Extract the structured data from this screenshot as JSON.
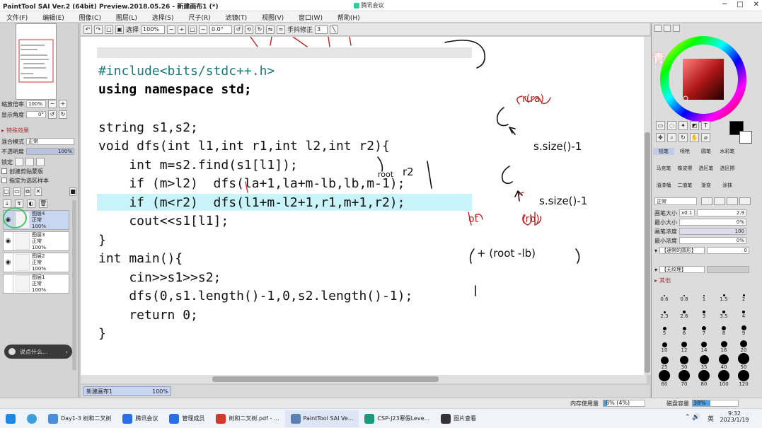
{
  "window": {
    "title": "PaintTool SAI Ver.2 (64bit) Preview.2018.05.26 - 新建画布1 (*)",
    "meeting_label": "腾讯会议",
    "controls": [
      "─",
      "□",
      "✕"
    ]
  },
  "menu": [
    "文件(F)",
    "编辑(E)",
    "图像(C)",
    "图层(L)",
    "选择(S)",
    "尺子(R)",
    "滤镜(T)",
    "视图(V)",
    "窗口(W)",
    "帮助(H)"
  ],
  "toolbar": {
    "select_label": "选择",
    "zoom": "100%",
    "rotation": "0.0°",
    "stabilizer_label": "手抖修正",
    "stabilizer_value": "3"
  },
  "left_panel": {
    "zoom_label": "缩放倍率",
    "zoom_value": "100%",
    "angle_label": "显示角度",
    "angle_value": "0°",
    "effects_label": "特殊效果",
    "blend_label": "混合模式",
    "blend_value": "正常",
    "opacity_label": "不透明度",
    "opacity_value": "100%",
    "lock_label": "锁定",
    "clip_label": "创建剪贴蒙版",
    "ref_label": "指定为选区样本",
    "layers": [
      {
        "name": "图层4",
        "mode": "正常",
        "opacity": "100%",
        "visible": true,
        "selected": true
      },
      {
        "name": "图层3",
        "mode": "正常",
        "opacity": "100%",
        "visible": true,
        "selected": false
      },
      {
        "name": "图层2",
        "mode": "正常",
        "opacity": "100%",
        "visible": true,
        "selected": false
      },
      {
        "name": "图层1",
        "mode": "正常",
        "opacity": "100%",
        "visible": false,
        "selected": false
      }
    ],
    "chat_placeholder": "说点什么..."
  },
  "code_lines": [
    {
      "text": "#include<bits/stdc++.h>",
      "kind": "pp"
    },
    {
      "text": "using namespace std;",
      "kind": "kwline"
    },
    {
      "text": "",
      "kind": "blank"
    },
    {
      "text": "string s1,s2;",
      "kind": "decl"
    },
    {
      "text": "void dfs(int l1,int r1,int l2,int r2){",
      "kind": "sig"
    },
    {
      "text": "    int m=s2.find(s1[l1]);",
      "kind": "body"
    },
    {
      "text": "    if (m>l2)  dfs(la+1,la+m-lb,lb,m-1);",
      "kind": "body"
    },
    {
      "text": "    if (m<r2)  dfs(l1+m-l2+1,r1,m+1,r2);",
      "kind": "body"
    },
    {
      "text": "    cout<<s1[l1];",
      "kind": "body"
    },
    {
      "text": "}",
      "kind": "brace"
    },
    {
      "text": "int main(){",
      "kind": "sig"
    },
    {
      "text": "    cin>>s1>>s2;",
      "kind": "body"
    },
    {
      "text": "    dfs(0,s1.length()-1,0,s2.length()-1);",
      "kind": "body"
    },
    {
      "text": "    return 0;",
      "kind": "body"
    },
    {
      "text": "}",
      "kind": "brace"
    }
  ],
  "canvas_tab": {
    "name": "新建画布1",
    "zoom": "100%"
  },
  "right_panel": {
    "watermark": "青",
    "brushes": [
      "铅笔",
      "喷枪",
      "圆笔",
      "水彩笔",
      "马克笔",
      "橡皮擦",
      "选区笔",
      "选区擦",
      "油漆桶",
      "二值笔",
      "渐变",
      "涂抹"
    ],
    "blend_mode": "正常",
    "brush_size_label": "画笔大小",
    "brush_size_mult": "x0.1",
    "brush_size_value": "2.9",
    "min_size_label": "最小大小",
    "min_size_value": "0%",
    "density_label": "画笔浓度",
    "density_value": "100",
    "min_density_label": "最小浓度",
    "min_density_value": "0%",
    "shape_label": "【通常的圆形】",
    "shape_value": "0",
    "texture_label": "【无纹理】",
    "other_label": "其他",
    "sizes": [
      "0.6",
      "0.8",
      "1",
      "1.5",
      "2",
      "2.3",
      "2.6",
      "3",
      "3.5",
      "4",
      "5",
      "6",
      "7",
      "8",
      "9",
      "10",
      "12",
      "14",
      "16",
      "20",
      "25",
      "30",
      "35",
      "40",
      "50",
      "60",
      "70",
      "80",
      "100",
      "120"
    ],
    "colors": {
      "main": "#000000",
      "sub": "#ffffff"
    }
  },
  "status": {
    "memory_label": "内存使用量",
    "memory_value": "8% (4%)",
    "disk_label": "磁盘容量",
    "disk_value": "38%"
  },
  "taskbar": {
    "items": [
      {
        "label": "Day1-3 树和二叉树",
        "color": "#4a8fd9"
      },
      {
        "label": "腾讯会议",
        "color": "#2a6fe8"
      },
      {
        "label": "管理成员",
        "color": "#2a6fe8"
      },
      {
        "label": "树和二叉树.pdf - ...",
        "color": "#d03a2a"
      },
      {
        "label": "PaintTool SAI Ve...",
        "color": "#5a7fb0"
      },
      {
        "label": "CSP-J23寒假Leve...",
        "color": "#1a9a7a"
      },
      {
        "label": "图片查看",
        "color": "#333333"
      }
    ],
    "ime": "英",
    "time": "9:32",
    "date": "2023/1/19"
  }
}
